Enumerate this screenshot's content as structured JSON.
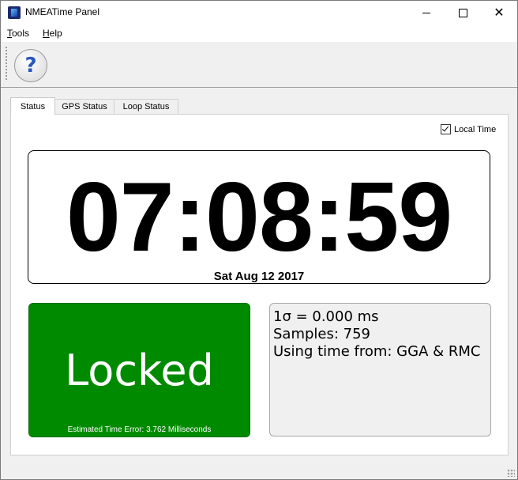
{
  "window": {
    "title": "NMEATime Panel"
  },
  "menu": {
    "tools": {
      "accel": "T",
      "rest": "ools"
    },
    "help": {
      "accel": "H",
      "rest": "elp"
    }
  },
  "toolbar": {
    "help_glyph": "?"
  },
  "tabs": [
    {
      "label": "Status",
      "active": true
    },
    {
      "label": "GPS Status",
      "active": false
    },
    {
      "label": "Loop Status",
      "active": false
    }
  ],
  "status": {
    "local_time_label": "Local Time",
    "local_time_checked": true,
    "clock_time": "07:08:59",
    "clock_date": "Sat Aug 12 2017",
    "lock_state": "Locked",
    "lock_color": "#008a00",
    "estimated_error": "Estimated Time Error: 3.762 Milliseconds",
    "stats": [
      "1σ = 0.000 ms",
      "Samples: 759",
      "Using time from: GGA & RMC"
    ]
  }
}
